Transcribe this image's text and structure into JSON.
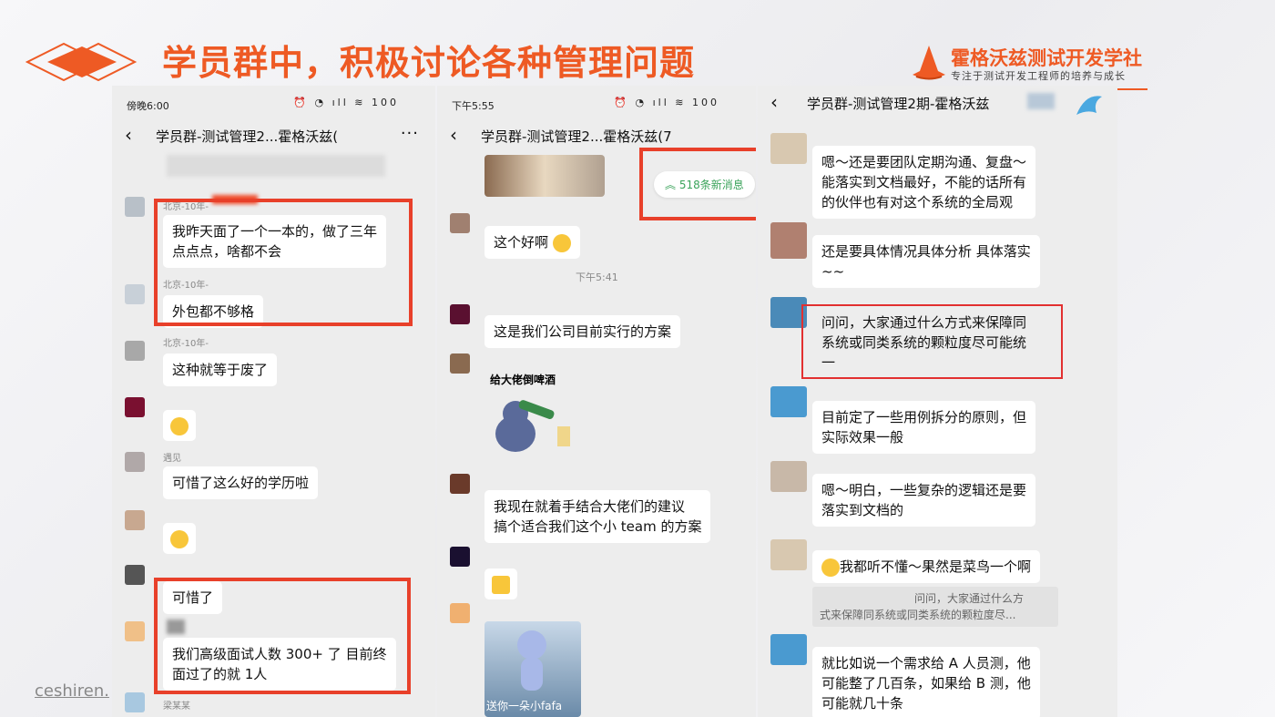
{
  "slide": {
    "title": "学员群中，积极讨论各种管理问题",
    "brand_name": "霍格沃兹测试开发学社",
    "brand_sub": "专注于测试开发工程师的培养与成长",
    "watermark": "ceshiren.",
    "accent_color": "#ee5a24"
  },
  "phone1": {
    "time": "傍晚6:00",
    "status_icons": "⏰ ◔ ıll ≋ 100",
    "title": "学员群-测试管理2...霍格沃兹(",
    "messages": [
      {
        "nick": "北京-10年-",
        "text_lines": [
          "我昨天面了一个一本的，做了三年",
          "点点点，啥都不会"
        ]
      },
      {
        "nick": "北京-10年-",
        "text": "外包都不够格"
      },
      {
        "nick": "北京-10年-",
        "text": "这种就等于废了"
      },
      {
        "nick": "遇见",
        "text": "可惜了这么好的学历啦"
      },
      {
        "text": "可惜了"
      },
      {
        "text_lines": [
          "我们高级面试人数 300+ 了 目前终",
          "面过了的就 1人"
        ]
      },
      {
        "nick": "梁某某"
      }
    ]
  },
  "phone2": {
    "time": "下午5:55",
    "status_icons": "⏰ ◔ ıll ≋ 100",
    "title": "学员群-测试管理2...霍格沃兹(7",
    "new_messages": "518条新消息",
    "time_separator": "下午5:41",
    "messages": [
      {
        "text": "这个好啊"
      },
      {
        "text": "这是我们公司目前实行的方案"
      },
      {
        "sticker_caption": "给大佬倒啤酒"
      },
      {
        "text_lines": [
          "我现在就着手结合大佬们的建议",
          "搞个适合我们这个小 team 的方案"
        ]
      },
      {
        "sticker_caption": "送你一朵小fafa"
      }
    ]
  },
  "phone3": {
    "title": "学员群-测试管理2期-霍格沃兹",
    "messages": [
      {
        "text_lines": [
          "嗯～还是要团队定期沟通、复盘～",
          "能落实到文档最好，不能的话所有",
          "的伙伴也有对这个系统的全局观"
        ]
      },
      {
        "text_lines": [
          "还是要具体情况具体分析 具体落实",
          "~~"
        ]
      },
      {
        "text_lines": [
          "问问，大家通过什么方式来保障同",
          "系统或同类系统的颗粒度尽可能统",
          "一"
        ]
      },
      {
        "text_lines": [
          "目前定了一些用例拆分的原则，但",
          "实际效果一般"
        ]
      },
      {
        "text_lines": [
          "嗯～明白，一些复杂的逻辑还是要",
          "落实到文档的"
        ]
      },
      {
        "text": "我都听不懂～果然是菜鸟一个啊",
        "quote_lines": [
          "问问，大家通过什么方",
          "式来保障同系统或同类系统的颗粒度尽..."
        ]
      },
      {
        "text_lines": [
          "就比如说一个需求给 A 人员测，他",
          "可能整了几百条，如果给 B 测，他",
          "可能就几十条"
        ]
      }
    ]
  }
}
